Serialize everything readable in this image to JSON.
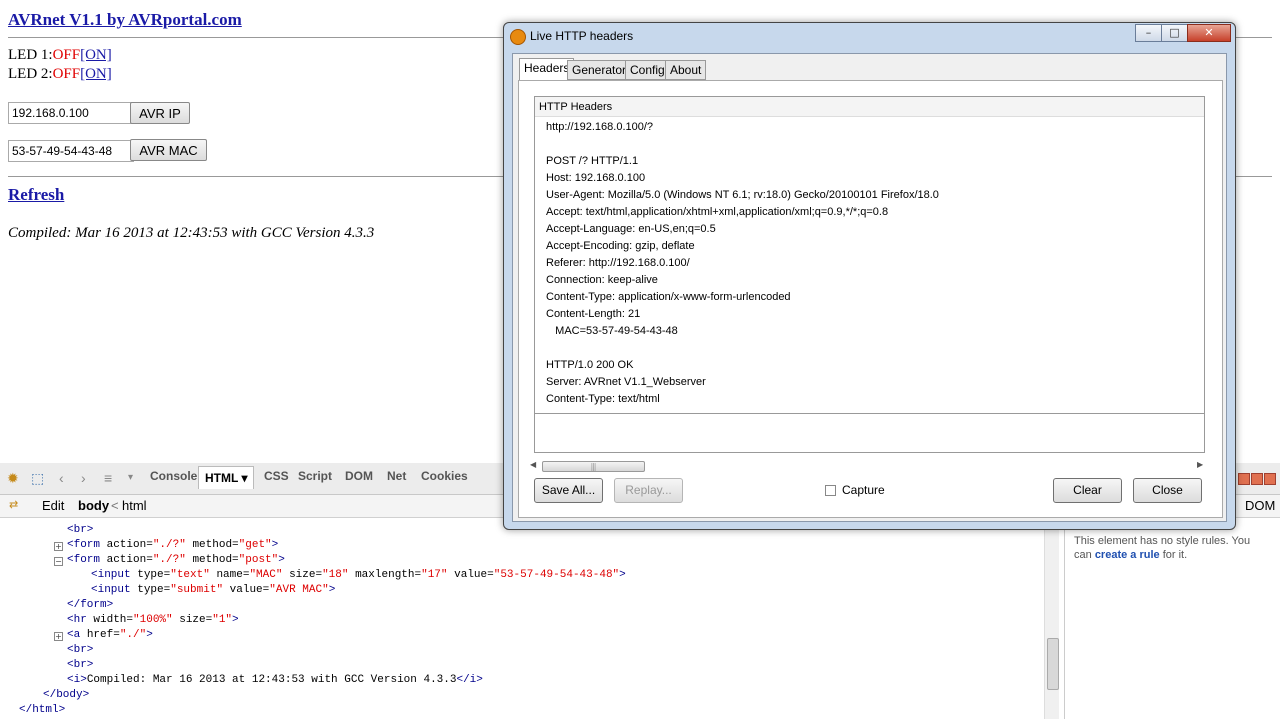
{
  "page": {
    "title": "AVRnet V1.1 by AVRportal.com",
    "led1_label": "LED 1:",
    "led1_state": "OFF",
    "led1_link": "[ON]",
    "led2_label": "LED 2:",
    "led2_state": "OFF",
    "led2_link": "[ON]",
    "ip_value": "192.168.0.100",
    "ip_button": "AVR IP",
    "mac_value": "53-57-49-54-43-48",
    "mac_button": "AVR MAC",
    "refresh": "Refresh",
    "compiled": "Compiled: Mar 16 2013 at 12:43:53 with GCC Version 4.3.3"
  },
  "firebug": {
    "tabs": [
      "Console",
      "HTML ▾",
      "CSS",
      "Script",
      "DOM",
      "Net",
      "Cookies"
    ],
    "edit": "Edit",
    "crumb_body": "body",
    "crumb_sep": "<",
    "crumb_html": "html",
    "side_tab": "DOM",
    "side_msg1": "This element has no style rules. You",
    "side_msg2": "can",
    "side_link": "create a rule",
    "side_msg3": "for it.",
    "code": {
      "l0": "<br>",
      "l1a": "<form ",
      "l1b": "action=",
      "l1c": "\"./?\"",
      "l1d": " method=",
      "l1e": "\"get\"",
      "l1f": ">",
      "l2a": "<form ",
      "l2b": "action=",
      "l2c": "\"./?\"",
      "l2d": " method=",
      "l2e": "\"post\"",
      "l2f": ">",
      "l3a": "<input ",
      "l3b": "type=",
      "l3c": "\"text\"",
      "l3d": " name=",
      "l3e": "\"MAC\"",
      "l3f": " size=",
      "l3g": "\"18\"",
      "l3h": " maxlength=",
      "l3i": "\"17\"",
      "l3j": " value=",
      "l3k": "\"53-57-49-54-43-48\"",
      "l3l": ">",
      "l4a": "<input ",
      "l4b": "type=",
      "l4c": "\"submit\"",
      "l4d": " value=",
      "l4e": "\"AVR MAC\"",
      "l4f": ">",
      "l5": "</form>",
      "l6a": "<hr ",
      "l6b": "width=",
      "l6c": "\"100%\"",
      "l6d": " size=",
      "l6e": "\"1\"",
      "l6f": ">",
      "l7a": "<a ",
      "l7b": "href=",
      "l7c": "\"./\"",
      "l7d": ">",
      "l8": "<br>",
      "l9": "<br>",
      "l10a": "<i>",
      "l10b": "Compiled: Mar 16 2013 at 12:43:53 with GCC Version 4.3.3",
      "l10c": "</i>",
      "l11": "</body>",
      "l12": "</html>"
    }
  },
  "dialog": {
    "title": "Live HTTP headers",
    "tabs": [
      "Headers",
      "Generator",
      "Config",
      "About"
    ],
    "caption": "HTTP Headers",
    "lines": [
      "http://192.168.0.100/?",
      "",
      "POST /? HTTP/1.1",
      "Host: 192.168.0.100",
      "User-Agent: Mozilla/5.0 (Windows NT 6.1; rv:18.0) Gecko/20100101 Firefox/18.0",
      "Accept: text/html,application/xhtml+xml,application/xml;q=0.9,*/*;q=0.8",
      "Accept-Language: en-US,en;q=0.5",
      "Accept-Encoding: gzip, deflate",
      "Referer: http://192.168.0.100/",
      "Connection: keep-alive",
      "Content-Type: application/x-www-form-urlencoded",
      "Content-Length: 21",
      "   MAC=53-57-49-54-43-48",
      "",
      "HTTP/1.0 200 OK",
      "Server: AVRnet V1.1_Webserver",
      "Content-Type: text/html"
    ],
    "save_all": "Save All...",
    "replay": "Replay...",
    "capture": "Capture",
    "clear": "Clear",
    "close": "Close"
  }
}
